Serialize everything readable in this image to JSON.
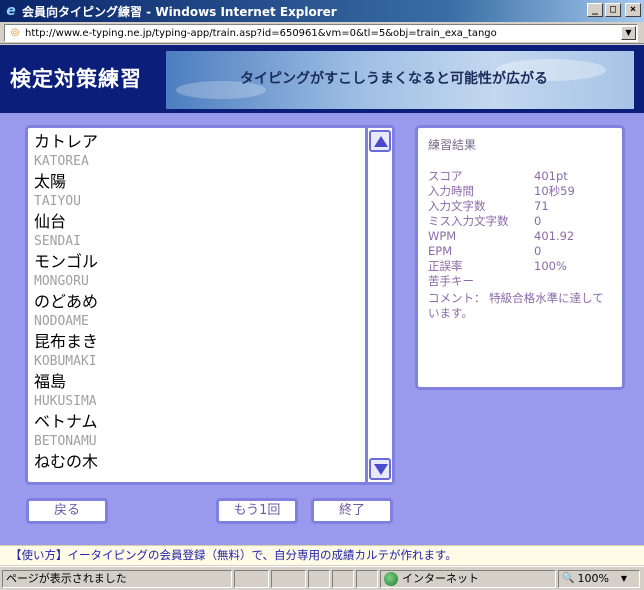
{
  "window": {
    "title": "会員向タイピング練習 - Windows Internet Explorer",
    "minimize": "_",
    "maximize": "□",
    "close": "×"
  },
  "address": {
    "url": "http://www.e-typing.ne.jp/typing-app/train.asp?id=650961&vm=0&tl=5&obj=train_exa_tango"
  },
  "header": {
    "title": "検定対策練習",
    "tagline": "タイピングがすこしうまくなると可能性が広がる"
  },
  "words": [
    {
      "word": "カトレア",
      "romaji": "KATOREA"
    },
    {
      "word": "太陽",
      "romaji": "TAIYOU"
    },
    {
      "word": "仙台",
      "romaji": "SENDAI"
    },
    {
      "word": "モンゴル",
      "romaji": "MONGORU"
    },
    {
      "word": "のどあめ",
      "romaji": "NODOAME"
    },
    {
      "word": "昆布まき",
      "romaji": "KOBUMAKI"
    },
    {
      "word": "福島",
      "romaji": "HUKUSIMA"
    },
    {
      "word": "ベトナム",
      "romaji": "BETONAMU"
    },
    {
      "word": "ねむの木",
      "romaji": ""
    }
  ],
  "result": {
    "title": "練習結果",
    "rows": [
      {
        "label": "スコア",
        "value": "401pt"
      },
      {
        "label": "入力時間",
        "value": "10秒59"
      },
      {
        "label": "入力文字数",
        "value": "71"
      },
      {
        "label": "ミス入力文字数",
        "value": "0"
      },
      {
        "label": "WPM",
        "value": "401.92"
      },
      {
        "label": "EPM",
        "value": "0"
      },
      {
        "label": "正誤率",
        "value": "100%"
      },
      {
        "label": "苦手キー",
        "value": ""
      }
    ],
    "comment": "コメント： 特級合格水準に達しています。"
  },
  "buttons": {
    "back": "戻る",
    "again": "もう1回",
    "end": "終了"
  },
  "info": "【使い方】イータイピングの会員登録（無料）で、自分専用の成績カルテが作れます。",
  "status": {
    "text": "ページが表示されました",
    "zone": "インターネット",
    "zoom": "100%"
  }
}
